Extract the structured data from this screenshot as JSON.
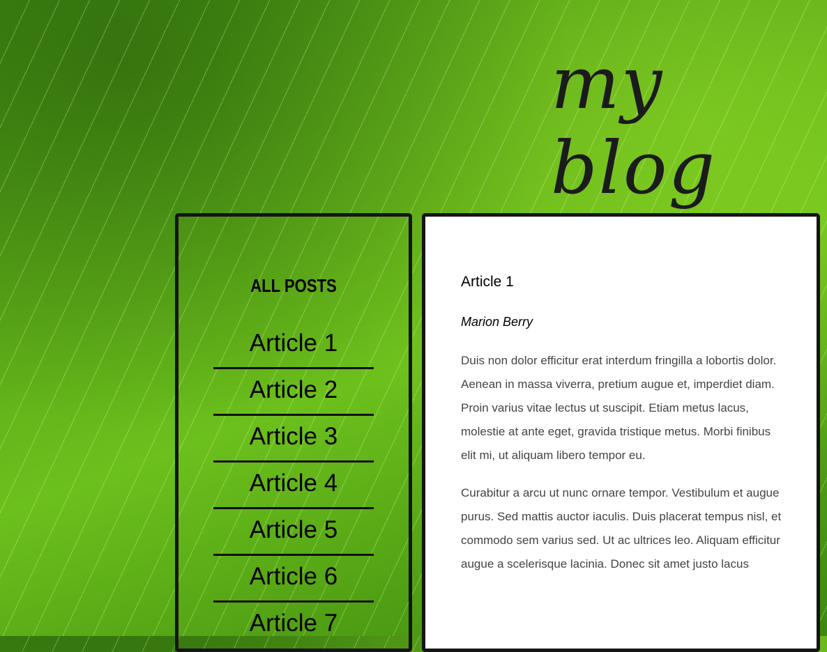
{
  "header": {
    "title": "my blog"
  },
  "sidebar": {
    "heading": "ALL POSTS",
    "items": [
      "Article 1",
      "Article 2",
      "Article 3",
      "Article 4",
      "Article 5",
      "Article 6",
      "Article 7"
    ]
  },
  "article": {
    "title": "Article 1",
    "author": "Marion Berry",
    "paragraphs": [
      "Duis non dolor efficitur erat interdum fringilla a lobortis dolor. Aenean in massa viverra, pretium augue et, imperdiet diam. Proin varius vitae lectus ut suscipit. Etiam metus lacus, molestie at ante eget, gravida tristique metus. Morbi finibus elit mi, ut aliquam libero tempor eu.",
      "Curabitur a arcu ut nunc ornare tempor. Vestibulum et augue purus. Sed mattis auctor iaculis. Duis placerat tempus nisl, et commodo sem varius sed. Ut ac ultrices leo. Aliquam efficitur augue a scelerisque lacinia. Donec sit amet justo lacus"
    ]
  }
}
